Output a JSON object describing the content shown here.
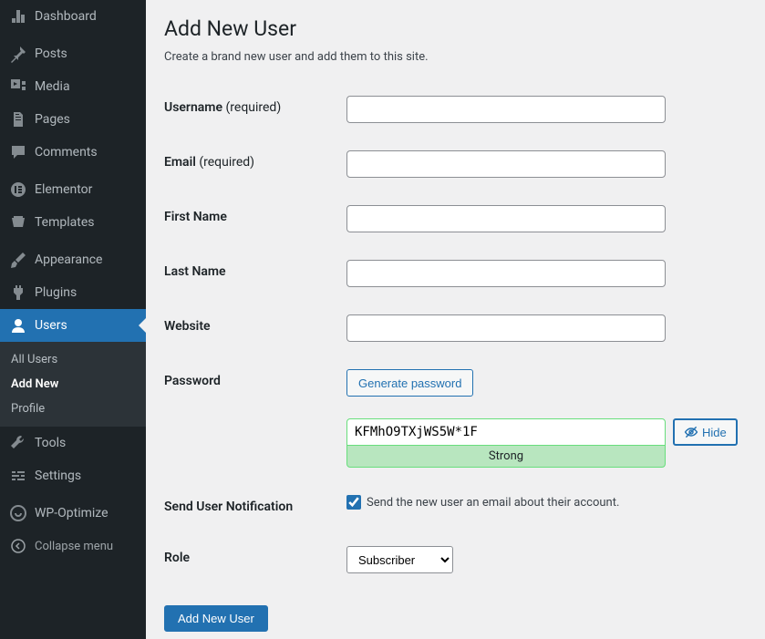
{
  "sidebar": {
    "items": [
      {
        "label": "Dashboard",
        "icon": "dashboard-icon"
      },
      {
        "label": "Posts",
        "icon": "pin-icon"
      },
      {
        "label": "Media",
        "icon": "media-icon"
      },
      {
        "label": "Pages",
        "icon": "pages-icon"
      },
      {
        "label": "Comments",
        "icon": "comments-icon"
      },
      {
        "label": "Elementor",
        "icon": "elementor-icon"
      },
      {
        "label": "Templates",
        "icon": "templates-icon"
      },
      {
        "label": "Appearance",
        "icon": "brush-icon"
      },
      {
        "label": "Plugins",
        "icon": "plugin-icon"
      },
      {
        "label": "Users",
        "icon": "user-icon"
      },
      {
        "label": "Tools",
        "icon": "wrench-icon"
      },
      {
        "label": "Settings",
        "icon": "sliders-icon"
      },
      {
        "label": "WP-Optimize",
        "icon": "optimize-icon"
      }
    ],
    "submenu": {
      "all_users": "All Users",
      "add_new": "Add New",
      "profile": "Profile"
    },
    "collapse": "Collapse menu"
  },
  "page": {
    "title": "Add New User",
    "description": "Create a brand new user and add them to this site."
  },
  "form": {
    "username_label": "Username",
    "required_suffix": "(required)",
    "email_label": "Email",
    "first_name_label": "First Name",
    "last_name_label": "Last Name",
    "website_label": "Website",
    "password_label": "Password",
    "generate_password_btn": "Generate password",
    "password_value": "KFMhO9TXjWS5W*1F",
    "password_strength": "Strong",
    "hide_btn": "Hide",
    "notification_label": "Send User Notification",
    "notification_text": "Send the new user an email about their account.",
    "notification_checked": true,
    "role_label": "Role",
    "role_value": "Subscriber",
    "submit_btn": "Add New User"
  }
}
